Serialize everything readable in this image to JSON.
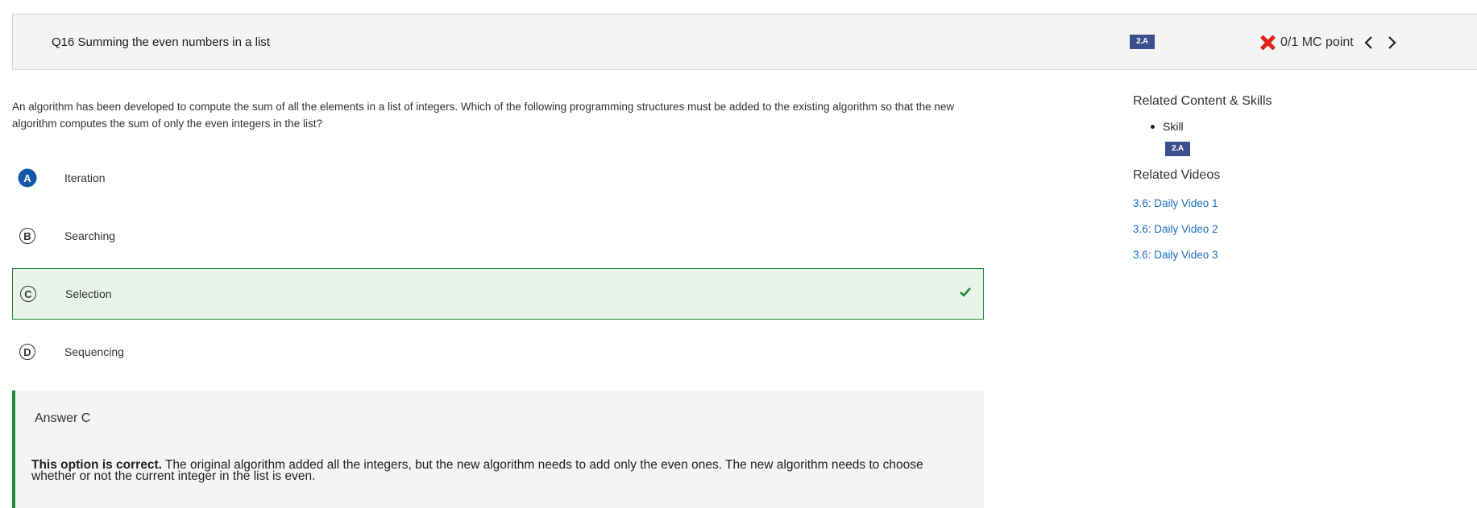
{
  "header": {
    "title": "Q16 Summing the even numbers in a list",
    "skill_badge": "2.A",
    "score": "0/1 MC point"
  },
  "question": {
    "stem": "An algorithm has been developed to compute the sum of all the elements in a list of integers. Which of the following programming structures must be added to the existing algorithm so that the new algorithm computes the sum of only the even integers in the list?",
    "options": [
      {
        "letter": "A",
        "text": "Iteration",
        "selected": true
      },
      {
        "letter": "B",
        "text": "Searching"
      },
      {
        "letter": "C",
        "text": "Selection",
        "correct": true
      },
      {
        "letter": "D",
        "text": "Sequencing"
      }
    ]
  },
  "answer": {
    "title": "Answer C",
    "lead": "This option is correct.",
    "explanation": " The original algorithm added all the integers, but the new algorithm needs to add only the even ones. The new algorithm needs to choose whether or not the current integer in the list is even."
  },
  "sidebar": {
    "related_heading": "Related Content & Skills",
    "skill_label": "Skill",
    "skill_badge": "2.A",
    "videos_heading": "Related Videos",
    "videos": [
      "3.6: Daily Video 1",
      "3.6: Daily Video 2",
      "3.6: Daily Video 3"
    ]
  },
  "colors": {
    "badge": "#3b4f8f",
    "incorrect_x": "#e2231a",
    "correct_green": "#1f8a3a",
    "correct_bg": "#e8f4ea",
    "selected_blue": "#1358a8",
    "link": "#1a6fc4"
  },
  "icons": {
    "score_status": "x-icon",
    "prev": "chevron-left-icon",
    "next": "chevron-right-icon",
    "correct_option": "check-icon"
  }
}
